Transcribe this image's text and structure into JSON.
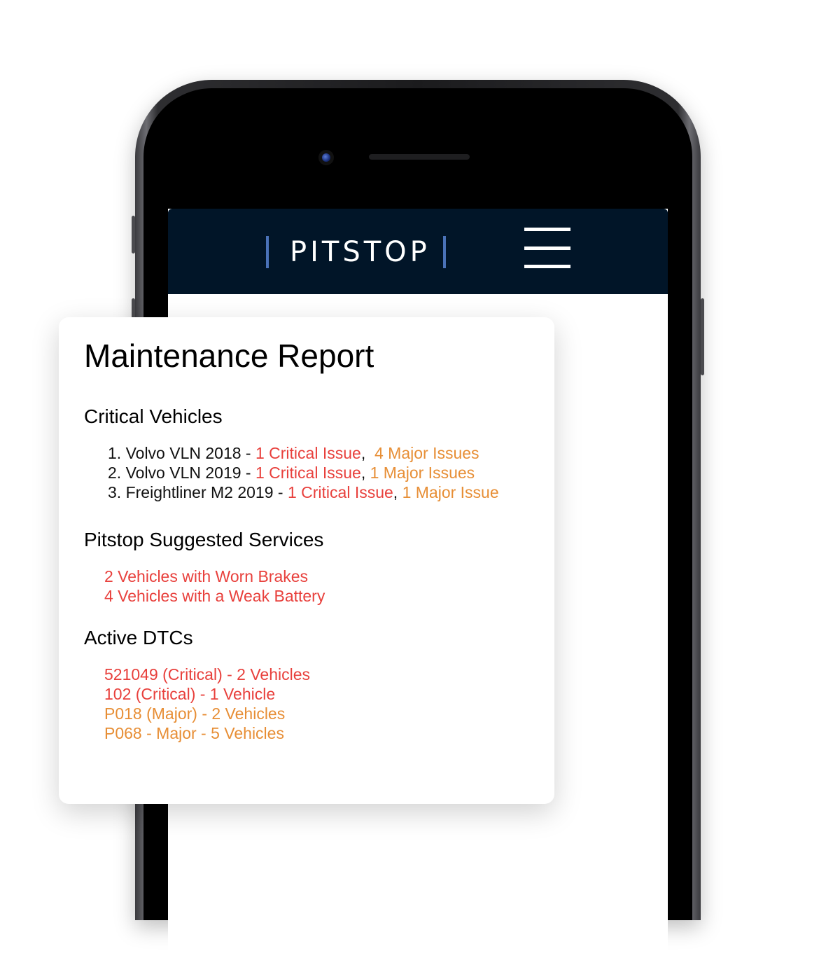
{
  "app": {
    "brand": "PITSTOP",
    "colors": {
      "navbar": "#011528",
      "accent": "#4a72b8",
      "critical": "#e8403c",
      "major": "#e78e35"
    }
  },
  "navbar": {
    "logo_text": "PITSTOP",
    "menu_icon": "hamburger-menu-icon"
  },
  "report": {
    "title": "Maintenance Report",
    "critical_vehicles": {
      "heading": "Critical Vehicles",
      "items": [
        {
          "num": "1.",
          "vehicle": "Volvo VLN 2018 - ",
          "critical": "1 Critical Issue",
          "sep": ",  ",
          "major": "4 Major Issues"
        },
        {
          "num": "2.",
          "vehicle": "Volvo VLN 2019 - ",
          "critical": "1 Critical Issue",
          "sep": ", ",
          "major": "1 Major Issues"
        },
        {
          "num": "3.",
          "vehicle": "Freightliner M2 2019 - ",
          "critical": "1 Critical Issue",
          "sep": ", ",
          "major": "1 Major Issue"
        }
      ]
    },
    "suggested_services": {
      "heading": "Pitstop Suggested Services",
      "items": [
        "2 Vehicles with Worn Brakes",
        "4 Vehicles with a Weak Battery"
      ]
    },
    "active_dtcs": {
      "heading": "Active DTCs",
      "items": [
        {
          "text": "521049 (Critical) - 2 Vehicles",
          "severity": "critical"
        },
        {
          "text": "102 (Critical) - 1 Vehicle",
          "severity": "critical"
        },
        {
          "text": "P018 (Major) - 2 Vehicles",
          "severity": "major"
        },
        {
          "text": "P068 - Major - 5 Vehicles",
          "severity": "major"
        }
      ]
    }
  }
}
